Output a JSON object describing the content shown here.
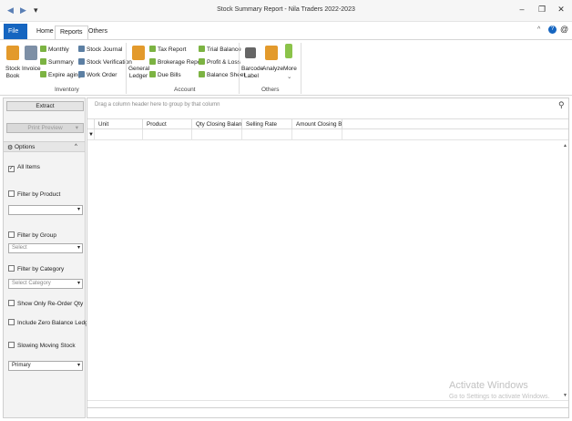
{
  "window": {
    "title": "Stock Summary Report - Nila Traders 2022-2023",
    "minimize": "–",
    "maximize": "❐",
    "close": "✕"
  },
  "quick_access": {
    "back": "◀",
    "forward": "▶",
    "menu": "▾"
  },
  "tabs": [
    {
      "label": "File"
    },
    {
      "label": "Home"
    },
    {
      "label": "Reports"
    },
    {
      "label": "Others"
    }
  ],
  "tab_right": {
    "collapse": "^",
    "help": "?",
    "about": "@"
  },
  "ribbon": {
    "inventory": {
      "group_label": "Inventory",
      "stock_book": "Stock Book",
      "invoice": "Invoice",
      "monthly": "Monthly",
      "summary": "Summary",
      "expire_aging": "Expire aging",
      "stock_journal": "Stock Journal",
      "stock_verification": "Stock Verification",
      "work_order": "Work Order"
    },
    "account": {
      "group_label": "Account",
      "general_ledger": "General Ledger",
      "tax_report": "Tax Report",
      "brokerage_report": "Brokerage Report",
      "due_bills": "Due Bills",
      "trial_balance": "Trial Balance",
      "profit_loss": "Profit & Loss",
      "balance_sheet": "Balance Sheet"
    },
    "others": {
      "group_label": "Others",
      "barcode_label": "Barcode Label",
      "analyze": "Analyze",
      "more": "More"
    }
  },
  "left": {
    "extract": "Extract",
    "print_preview": "Print Preview",
    "options": "Options",
    "all_items": "All Items",
    "filter_product": "Filter by Product",
    "filter_group": "Filter by Group",
    "group_placeholder": "Select",
    "filter_category": "Filter by Category",
    "category_placeholder": "Select Category",
    "reorder_qty": "Show Only Re-Order Qty",
    "zero_balance": "Include Zero Balance Ledger",
    "slowing_stock": "Slowing Moving Stock",
    "primary": "Primary"
  },
  "grid": {
    "group_hint": "Drag a column header here to group by that column",
    "columns": [
      "Unit",
      "Product",
      "Qty Closing Balance",
      "Selling Rate",
      "Amount Closing Ba..."
    ],
    "search_icon": "⚲"
  },
  "watermark": {
    "line1": "Activate Windows",
    "line2": "Go to Settings to activate Windows."
  }
}
